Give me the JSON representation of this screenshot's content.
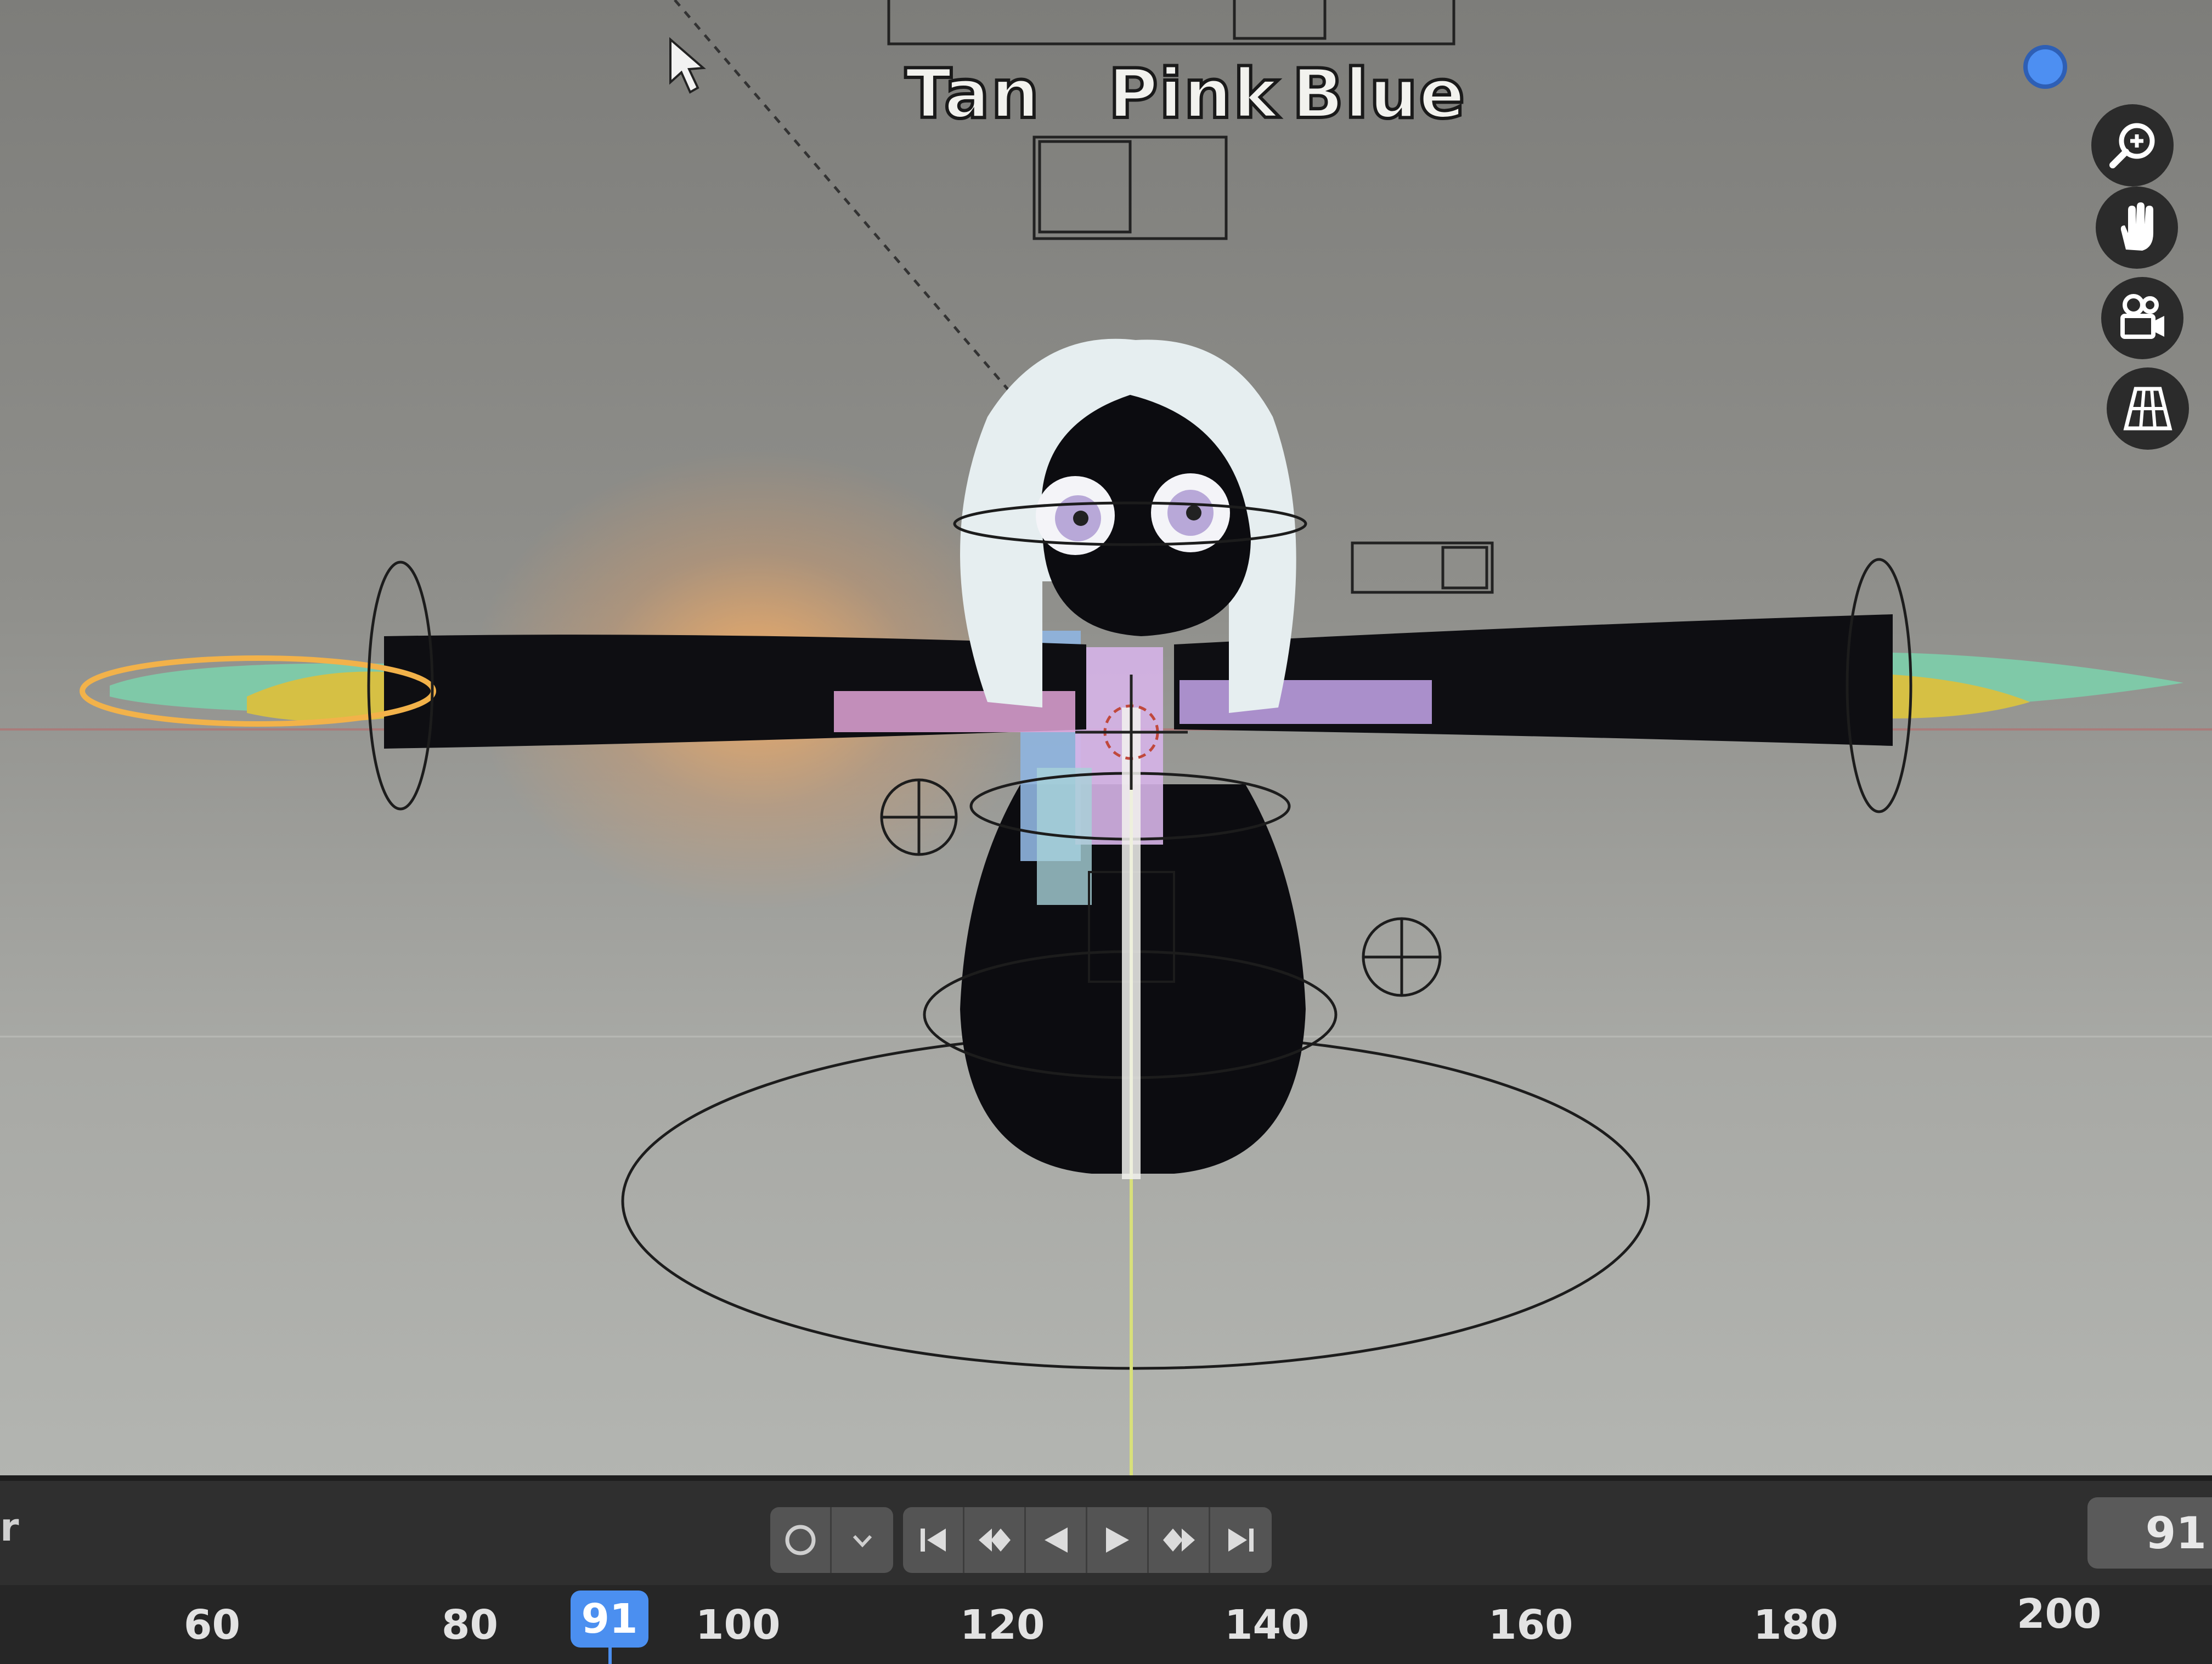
{
  "viewport": {
    "shape_key_labels": [
      "Tan",
      "Pink",
      "Blue"
    ]
  },
  "navigation": {
    "zoom": "zoom-in-icon",
    "pan": "hand-pan-icon",
    "camera": "camera-view-icon",
    "ortho": "ortho-grid-icon"
  },
  "timeline": {
    "header_fragment": "r",
    "current_frame": "91",
    "current_frame_field": "91",
    "ticks": [
      "60",
      "80",
      "100",
      "120",
      "140",
      "160",
      "180",
      "200"
    ],
    "playback_icons": [
      "record-circle-icon",
      "chevron-down-icon",
      "jump-start-icon",
      "prev-keyframe-icon",
      "play-reverse-icon",
      "play-icon",
      "next-keyframe-icon",
      "jump-end-icon"
    ]
  },
  "colors": {
    "accent_blue": "#4b8ff0",
    "selection_orange": "#f2b24a",
    "timeline_bg": "#2f2f2f"
  }
}
